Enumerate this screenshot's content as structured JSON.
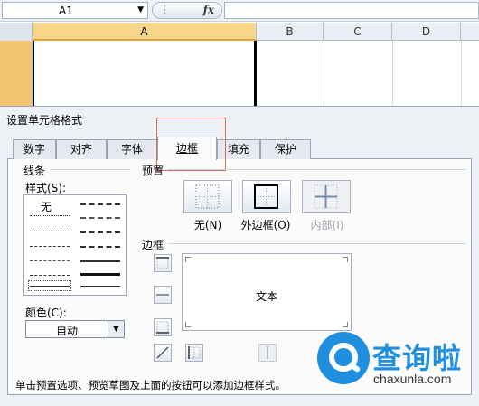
{
  "formula_bar": {
    "name_box": "A1",
    "fx_label": "fx"
  },
  "columns": [
    "A",
    "B",
    "C",
    "D"
  ],
  "dialog": {
    "title": "设置单元格格式",
    "tabs": [
      "数字",
      "对齐",
      "字体",
      "边框",
      "填充",
      "保护"
    ],
    "active_tab": "边框",
    "line": {
      "group_label": "线条",
      "style_label": "样式(S):",
      "none_label": "无",
      "color_label": "颜色(C):",
      "color_value": "自动"
    },
    "presets": {
      "group_label": "预置",
      "none": "无(N)",
      "outline": "外边框(O)",
      "inside": "内部(I)"
    },
    "border": {
      "group_label": "边框",
      "preview_text": "文本"
    },
    "hint": "单击预置选项、预览草图及上面的按钮可以添加边框样式。"
  },
  "watermark": {
    "text": "查询啦",
    "url": "chaxunla.com",
    "color": "#1f8fdf"
  },
  "colors": {
    "active_column": "#f8d689",
    "highlight_box": "#e06a5a"
  }
}
